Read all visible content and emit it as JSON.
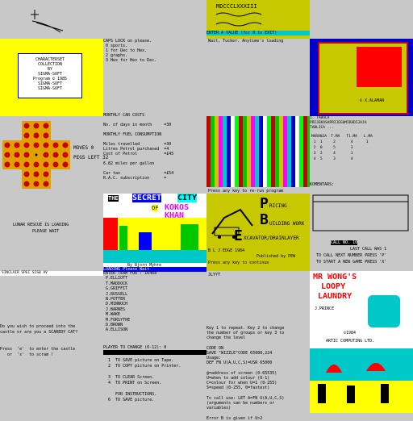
{
  "page_title": "ZX Spectrum loading screens contact sheet",
  "r0": {
    "c2_text": "",
    "c3_title": "MDCCCLXXXIII",
    "c3_prompt": "ENTER A VALUE (for 0 to EXIT)",
    "c3_line": "Wait, Tucker. Anytime's loading"
  },
  "r1": {
    "c0_title": "CHARACTERSET\nCOLLECTION\nBY\nSIGMA-SOFT\nProgram © 1985\nSIGMA-SOFT\nSIGMA-SOFT",
    "c1_text": "CAPS LOCK on please.\n 0 sports.\n 1 for Dec to Hex.\n 2 graphs.\n 3 Hex for Hex to Dec.",
    "c3_copyright": "© X.ALAMAN"
  },
  "r2": {
    "c0_moves": "MOVES 0",
    "c0_pegs": "PEGS LEFT 32",
    "c1_text": "MONTHLY CAR COSTS\n\nNo. of days in month     =30\n\nMONTHLY FUEL CONSUMPTION\n\nMiles travelled          =30\nLitres Petrol purchased  =4\nCost of Petrol           =£45\n\n6.82 miles per gallon\n\nCar tax                  =£54\nR.A.C. subscription      =",
    "c2_footer": "Press any key to re-run program",
    "c3_text": "1. TABULA\nPRIJEKOSAPRIJEGUMIRADIJAJA\nTABLICA ...",
    "c3_table": "MARANJA  T.MA   T1.MA   L.MA\n 1  1     2       4      1\n 2  0     5       3\n 3  2     4       1\n 4  5     3       4"
  },
  "r3": {
    "c0_loading": "LUNAR RESCUE IS LOADING",
    "c0_wait": "PLEASE WAIT",
    "c1_the": "THE",
    "c1_secret": "SECRET",
    "c1_city": "CITY",
    "c1_of": "OF",
    "c1_kokos": "KOKOS",
    "c1_khan": "KHAN",
    "c1_by": "By Bjorn Myhre",
    "c1_loading": "LOADING      Please Wait",
    "c2_footer": "Press any key to rerun program scroll?",
    "c2_p": "P",
    "c2_ricing": "RICING",
    "c2_b": "B",
    "c2_uilding": "UILDING WORK",
    "c2_e": "E",
    "c2_xcav": "XCAVATOR/DRAINLAYER",
    "c2_credit": "B L J EDGE 1984",
    "c2_publish": "Published by PEW",
    "c2_continue": "Press any key to continue",
    "c3_top": "KOMENTARS:",
    "c3_call": "CALL NO.    10",
    "c3_last": "LAST CALL WAS 1",
    "c3_next": "TO CALL NEXT NUMBER PRESS 'P'",
    "c3_start": "TO START A NEW GAME PRESS 'X'"
  },
  "r4": {
    "c0_text": "SINCLAIR SPEC        SIS8 AV",
    "c1_team": "ENTER TEAM FOR : 16468\n P.ELLIOTT\n T.MADDOCK\n G.GRIFFIT\n J.RUSSELL\n N.POTTER\n D.MINNOCH\n J.BARNES\n M.WAKE\n M.FORSYTHE\n D.BROWN\n A.ELLISON",
    "c2_text": "JLYYT",
    "c3_title_1": "MR WONG'S",
    "c3_title_2": "LOOPY",
    "c3_title_3": "LAUNDRY",
    "c3_credit": "J.PRINCE",
    "c3_year": "©1984",
    "c3_company": "ARTIC COMPUTING LTD."
  },
  "r5": {
    "c0_text": "Do you wish to proceed into the\ncastle or are you a SCAREDY CAT?\n\n\nPress  'e'  to enter the castle\n   or  's'  to scram !",
    "c1_head": "PLAYER TO CHANGE (0-12): 0",
    "c1_menu": "  1  TO SAVE picture on Tape.\n  2  TO COPY picture on Printer.\n\n  3  TO CLEAR Screen.\n  4  TO PRINT on Screen.\n\n     FOR INSTRUCTIONS.\n  6  TO SAVE picture.",
    "c2_text": "Key 1 to repeat. Key 2 to change\nthe number of groups or key 3 to\nchange the level\n\nCODE ON\nSAVE \"WIZZLE\"CODE 65000,224\nUsage:\nDEF FN U(A,U,C,S)=USR 65000\n\n@=address of screen (0-65535)\nU=when to add colour (0-1)\nC=colour for when U=1 (0-255)\nS=speed (0-255, 0=fastest)\n\nTo call use: LET A=FN U(A,U,C,S)\n(arguments can be numbers or\nvariables)\n\nError B is given if U>2"
  }
}
